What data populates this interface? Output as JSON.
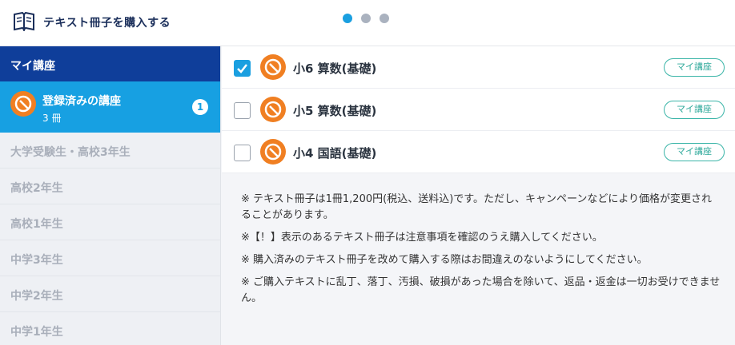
{
  "header": {
    "title": "テキスト冊子を購入する",
    "pager": {
      "count": 3,
      "active": 0
    },
    "book_icon": "open-book-icon"
  },
  "sidebar": {
    "my_courses_heading": "マイ講座",
    "registered": {
      "label": "登録済みの講座",
      "count_text": "3 冊",
      "badge": "1",
      "icon": "course-logo-icon"
    },
    "categories": [
      "大学受験生・高校3年生",
      "高校2年生",
      "高校1年生",
      "中学3年生",
      "中学2年生",
      "中学1年生"
    ]
  },
  "courses": [
    {
      "name": "小6 算数(基礎)",
      "tag": "マイ講座",
      "checked": true
    },
    {
      "name": "小5 算数(基礎)",
      "tag": "マイ講座",
      "checked": false
    },
    {
      "name": "小4 国語(基礎)",
      "tag": "マイ講座",
      "checked": false
    }
  ],
  "notes": [
    "※ テキスト冊子は1冊1,200円(税込、送料込)です。ただし、キャンペーンなどにより価格が変更されることがあります。",
    "※【！】表示のあるテキスト冊子は注意事項を確認のうえ購入してください。",
    "※ 購入済みのテキスト冊子を改めて購入する際はお間違えのないようにしてください。",
    "※ ご購入テキストに乱丁、落丁、汚損、破損があった場合を除いて、返品・返金は一切お受けできません。"
  ],
  "colors": {
    "accent": "#17a0e2",
    "navy": "#0f3e9a",
    "tag": "#3bb5a8",
    "logo": "#f07f22"
  }
}
